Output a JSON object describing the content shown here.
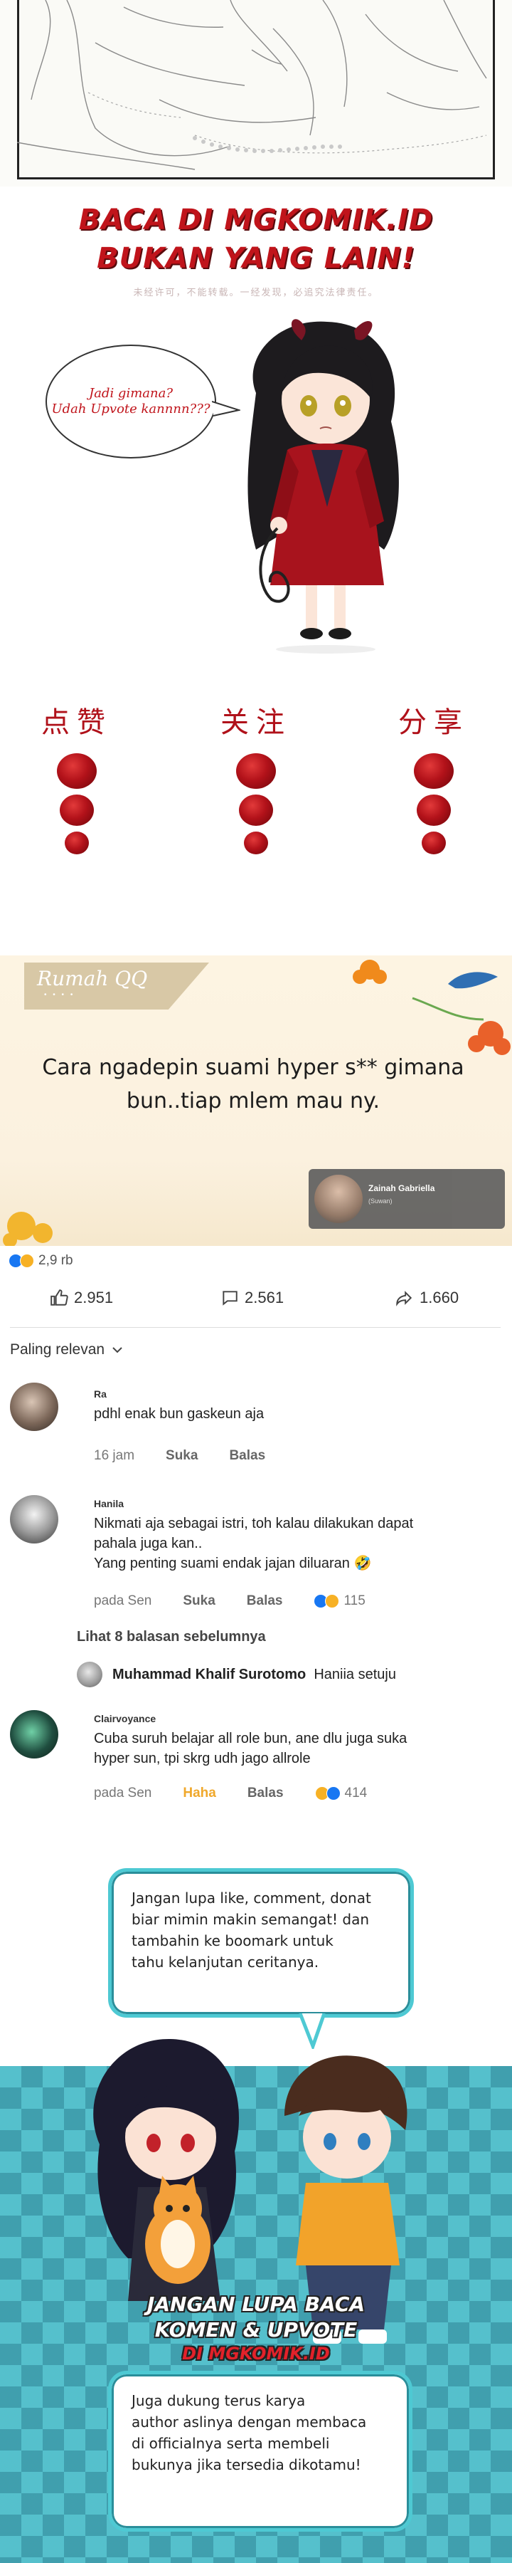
{
  "promo": {
    "title_line1": "BACA DI MGKOMIK.ID",
    "title_line2": "BUKAN YANG LAIN!",
    "subtitle": "未经许可，不能转载。一经发现，必追究法律责任。",
    "bubble_line1": "Jadi gimana?",
    "bubble_line2": "Udah Upvote kannnn???",
    "reactions": [
      {
        "label": "点赞"
      },
      {
        "label": "关注"
      },
      {
        "label": "分享"
      }
    ],
    "accent_color": "#c0141b"
  },
  "post": {
    "brand": "Rumah QQ",
    "brand_sub": "• • • •",
    "text": "Cara ngadepin suami hyper s** gimana bun..tiap mlem mau ny.",
    "author_name": "Zainah Gabriella",
    "author_tag": "(Suwan)",
    "reaction_count": "2,9 rb",
    "likes": "2.951",
    "comments": "2.561",
    "shares": "1.660",
    "sort_label": "Paling relevan",
    "icons": [
      "thumbs-up-icon",
      "comment-icon",
      "share-icon",
      "chevron-down-icon"
    ]
  },
  "comments": [
    {
      "name": "Ra",
      "text": "pdhl enak bun gaskeun aja",
      "time": "16 jam",
      "like": "Suka",
      "reply": "Balas"
    },
    {
      "name": "Hanila",
      "text_line1": "Nikmati aja sebagai istri, toh kalau dilakukan dapat",
      "text_line2": "pahala juga kan..",
      "text_line3": "Yang penting suami endak jajan diluaran 🤣",
      "time": "pada Sen",
      "like": "Suka",
      "reply": "Balas",
      "count": "115"
    },
    {
      "name": "Clairvoyance",
      "text_line1": "Cuba suruh belajar all role bun, ane dlu juga suka",
      "text_line2": "hyper sun, tpi skrg udh jago allrole",
      "time": "pada Sen",
      "like": "Haha",
      "reply": "Balas",
      "count": "414"
    }
  ],
  "replies": {
    "see_more": "Lihat 8 balasan sebelumnya",
    "reply_author": "Muhammad Khalif Surotomo",
    "reply_text": "Haniia setuju"
  },
  "closing": {
    "top_line1": "Jangan lupa like, comment, donat",
    "top_line2": "biar mimin makin semangat! dan",
    "top_line3": "tambahin ke boomark untuk",
    "top_line4": "tahu kelanjutan ceritanya.",
    "title_line1": "JANGAN LUPA BACA",
    "title_line2": "KOMEN & UPVOTE",
    "title_line3": "DI MGKOMIK.ID",
    "bottom_line1": "Juga dukung terus karya",
    "bottom_line2": "author aslinya dengan membaca",
    "bottom_line3": "di officialnya serta membeli",
    "bottom_line4": "bukunya jika tersedia dikotamu!",
    "border_color": "#4ec9d3"
  }
}
